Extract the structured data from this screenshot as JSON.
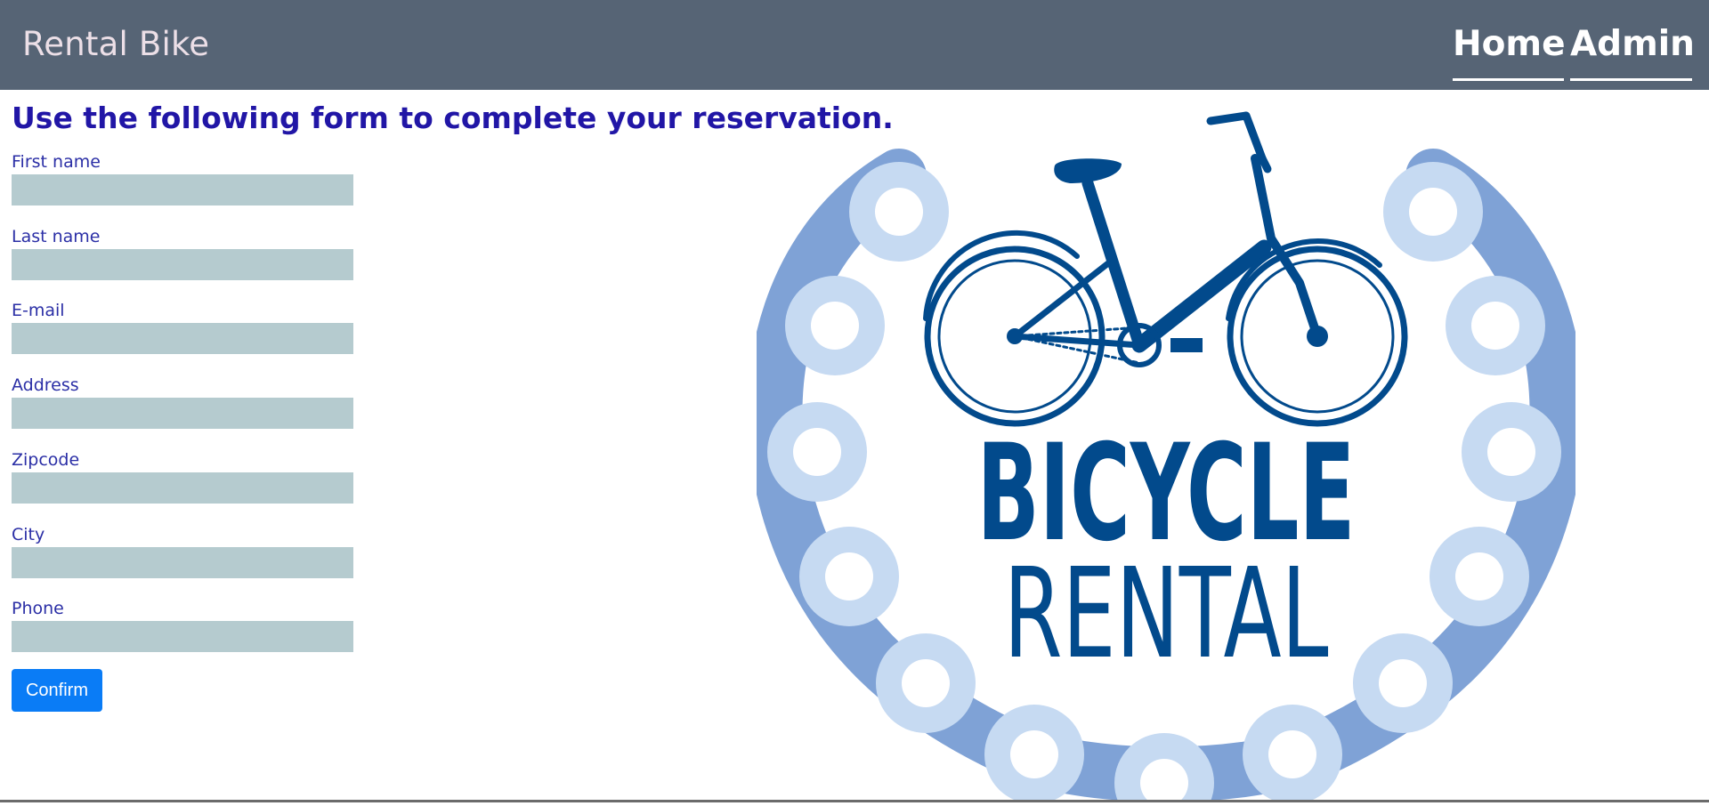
{
  "navbar": {
    "brand": "Rental Bike",
    "links": [
      {
        "label": "Home"
      },
      {
        "label": "Admin"
      }
    ]
  },
  "form": {
    "heading": "Use the following form to complete your reservation.",
    "fields": [
      {
        "label": "First name",
        "value": ""
      },
      {
        "label": "Last name",
        "value": ""
      },
      {
        "label": "E-mail",
        "value": ""
      },
      {
        "label": "Address",
        "value": ""
      },
      {
        "label": "Zipcode",
        "value": ""
      },
      {
        "label": "City",
        "value": ""
      },
      {
        "label": "Phone",
        "value": ""
      }
    ],
    "confirm_label": "Confirm"
  },
  "logo": {
    "line1": "BICYCLE",
    "line2": "RENTAL",
    "icon": "bicycle-icon",
    "colors": {
      "dark_blue": "#024a8c",
      "chain_light": "#c6daf2",
      "chain_mid": "#7fa2d6"
    }
  },
  "colors": {
    "navbar_bg": "#566475",
    "heading": "#2116a6",
    "input_bg": "#b5cbcf",
    "button_bg": "#0a7cf6"
  }
}
